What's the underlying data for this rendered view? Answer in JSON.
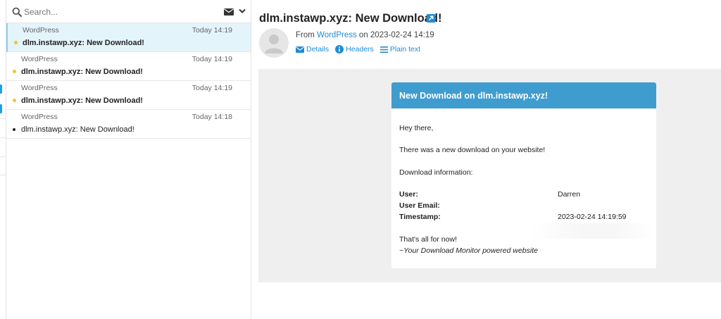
{
  "search": {
    "placeholder": "Search..."
  },
  "messages": [
    {
      "sender": "WordPress",
      "time": "Today 14:19",
      "subject": "dlm.instawp.xyz: New Download!"
    },
    {
      "sender": "WordPress",
      "time": "Today 14:19",
      "subject": "dlm.instawp.xyz: New Download!"
    },
    {
      "sender": "WordPress",
      "time": "Today 14:19",
      "subject": "dlm.instawp.xyz: New Download!"
    },
    {
      "sender": "WordPress",
      "time": "Today 14:18",
      "subject": "dlm.instawp.xyz: New Download!"
    }
  ],
  "reader": {
    "subject": "dlm.instawp.xyz: New Download!",
    "from_prefix": "From",
    "from_name": "WordPress",
    "from_suffix": "on 2023-02-24 14:19",
    "links": {
      "details": "Details",
      "headers": "Headers",
      "plain": "Plain text"
    }
  },
  "email": {
    "header": "New Download on dlm.instawp.xyz!",
    "greeting": "Hey there,",
    "line1": "There was a new download on your website!",
    "info_title": "Download information:",
    "user_label": "User:",
    "user_value": "Darren",
    "email_label": "User Email:",
    "email_value": "",
    "timestamp_label": "Timestamp:",
    "timestamp_value": "2023-02-24 14:19:59",
    "closing": "That's all for now!",
    "signature": "~Your Download Monitor powered website"
  },
  "colors": {
    "accent": "#1e8cd6",
    "card_header": "#3f9ccf",
    "unread_dot": "#f1c232",
    "selected_row": "#e4f4fb"
  },
  "icons": {
    "search": "search-icon",
    "mail": "envelope-icon",
    "chevron": "chevron-down-icon",
    "external": "external-link-icon",
    "details": "envelope-icon",
    "headers": "info-icon",
    "plain": "list-icon"
  }
}
